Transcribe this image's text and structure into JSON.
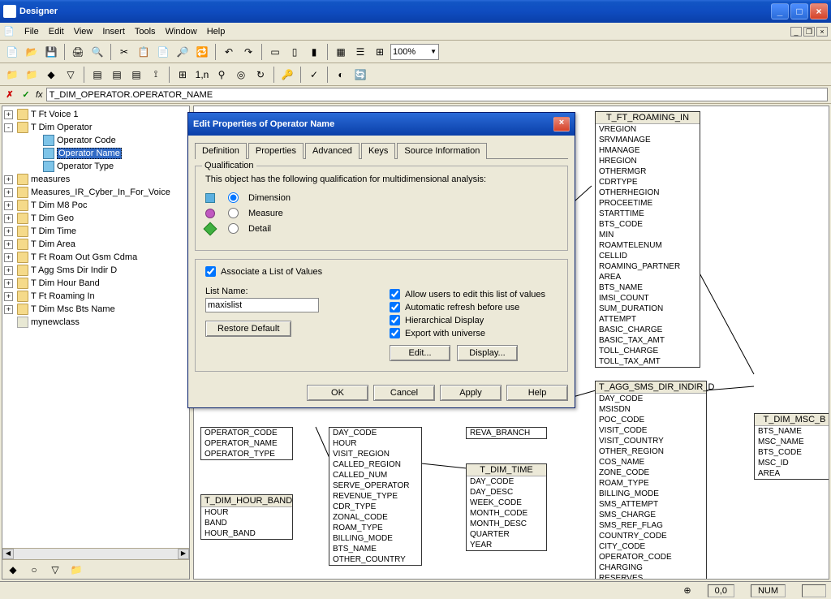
{
  "app": {
    "title": "Designer"
  },
  "menu": {
    "items": [
      "File",
      "Edit",
      "View",
      "Insert",
      "Tools",
      "Window",
      "Help"
    ]
  },
  "toolbar": {
    "zoom": "100%"
  },
  "formula": {
    "value": "T_DIM_OPERATOR.OPERATOR_NAME"
  },
  "tree": {
    "items": [
      {
        "exp": "+",
        "icon": "folder",
        "label": "T Ft Voice 1",
        "indent": 0
      },
      {
        "exp": "-",
        "icon": "folder",
        "label": "T Dim Operator",
        "indent": 0
      },
      {
        "exp": "",
        "icon": "obj",
        "label": "Operator Code",
        "indent": 2
      },
      {
        "exp": "",
        "icon": "obj",
        "label": "Operator Name",
        "indent": 2,
        "selected": true
      },
      {
        "exp": "",
        "icon": "obj",
        "label": "Operator Type",
        "indent": 2
      },
      {
        "exp": "+",
        "icon": "folder",
        "label": "measures",
        "indent": 0
      },
      {
        "exp": "+",
        "icon": "folder",
        "label": "Measures_IR_Cyber_In_For_Voice",
        "indent": 0
      },
      {
        "exp": "+",
        "icon": "folder",
        "label": "T Dim M8 Poc",
        "indent": 0
      },
      {
        "exp": "+",
        "icon": "folder",
        "label": "T Dim Geo",
        "indent": 0
      },
      {
        "exp": "+",
        "icon": "folder",
        "label": "T Dim Time",
        "indent": 0
      },
      {
        "exp": "+",
        "icon": "folder",
        "label": "T Dim Area",
        "indent": 0
      },
      {
        "exp": "+",
        "icon": "folder",
        "label": "T Ft Roam Out Gsm Cdma",
        "indent": 0
      },
      {
        "exp": "+",
        "icon": "folder",
        "label": "T Agg Sms Dir Indir D",
        "indent": 0
      },
      {
        "exp": "+",
        "icon": "folder",
        "label": "T Dim Hour Band",
        "indent": 0
      },
      {
        "exp": "+",
        "icon": "folder",
        "label": "T Ft Roaming In",
        "indent": 0
      },
      {
        "exp": "+",
        "icon": "folder",
        "label": "T Dim Msc Bts Name",
        "indent": 0
      },
      {
        "exp": "",
        "icon": "class",
        "label": "mynewclass",
        "indent": 0
      }
    ]
  },
  "dialog": {
    "title": "Edit Properties of Operator Name",
    "tabs": [
      "Definition",
      "Properties",
      "Advanced",
      "Keys",
      "Source Information"
    ],
    "activeTab": 1,
    "qual": {
      "group": "Qualification",
      "desc": "This object has the following qualification for multidimensional analysis:",
      "optDimension": "Dimension",
      "optMeasure": "Measure",
      "optDetail": "Detail"
    },
    "lov": {
      "associate": "Associate a List of Values",
      "listNameLabel": "List Name:",
      "listNameValue": "maxislist",
      "restore": "Restore Default",
      "allowEdit": "Allow users to edit this list of values",
      "autoRefresh": "Automatic refresh before use",
      "hierarchical": "Hierarchical Display",
      "exportUniv": "Export with universe",
      "edit": "Edit...",
      "display": "Display..."
    },
    "buttons": {
      "ok": "OK",
      "cancel": "Cancel",
      "apply": "Apply",
      "help": "Help"
    }
  },
  "tables": {
    "roaming_in": {
      "name": "T_FT_ROAMING_IN",
      "cols": [
        "VREGION",
        "SRVMANAGE",
        "HMANAGE",
        "HREGION",
        "OTHERMGR",
        "CDRTYPE",
        "OTHERHEGION",
        "PROCEETIME",
        "STARTTIME",
        "BTS_CODE",
        "MIN",
        "ROAMTELENUM",
        "CELLID",
        "ROAMING_PARTNER",
        "AREA",
        "BTS_NAME",
        "IMSI_COUNT",
        "SUM_DURATION",
        "ATTEMPT",
        "BASIC_CHARGE",
        "BASIC_TAX_AMT",
        "TOLL_CHARGE",
        "TOLL_TAX_AMT"
      ]
    },
    "agg_sms": {
      "name": "T_AGG_SMS_DIR_INDIR_D",
      "cols": [
        "DAY_CODE",
        "MSISDN",
        "POC_CODE",
        "VISIT_CODE",
        "VISIT_COUNTRY",
        "OTHER_REGION",
        "COS_NAME",
        "ZONE_CODE",
        "ROAM_TYPE",
        "BILLING_MODE",
        "SMS_ATTEMPT",
        "SMS_CHARGE",
        "SMS_REF_FLAG",
        "COUNTRY_CODE",
        "CITY_CODE",
        "OPERATOR_CODE",
        "CHARGING",
        "RESERVES"
      ]
    },
    "msc_b": {
      "name": "T_DIM_MSC_B",
      "cols": [
        "BTS_NAME",
        "MSC_NAME",
        "BTS_CODE",
        "MSC_ID",
        "AREA"
      ]
    },
    "operator": {
      "name": "T_DIM_OPERATOR",
      "cols": [
        "OPERATOR_CODE",
        "OPERATOR_NAME",
        "OPERATOR_TYPE"
      ]
    },
    "hour_band": {
      "name": "T_DIM_HOUR_BAND",
      "cols": [
        "HOUR",
        "BAND",
        "HOUR_BAND"
      ]
    },
    "voice_cols": {
      "cols": [
        "DAY_CODE",
        "HOUR",
        "VISIT_REGION",
        "CALLED_REGION",
        "CALLED_NUM",
        "SERVE_OPERATOR",
        "REVENUE_TYPE",
        "CDR_TYPE",
        "ZONAL_CODE",
        "ROAM_TYPE",
        "BILLING_MODE",
        "BTS_NAME",
        "OTHER_COUNTRY"
      ]
    },
    "branch": {
      "cols": [
        "REVA_BRANCH"
      ]
    },
    "dim_time": {
      "name": "T_DIM_TIME",
      "cols": [
        "DAY_CODE",
        "DAY_DESC",
        "WEEK_CODE",
        "MONTH_CODE",
        "MONTH_DESC",
        "QUARTER",
        "YEAR"
      ]
    }
  },
  "status": {
    "coords": "0,0",
    "num": "NUM"
  }
}
